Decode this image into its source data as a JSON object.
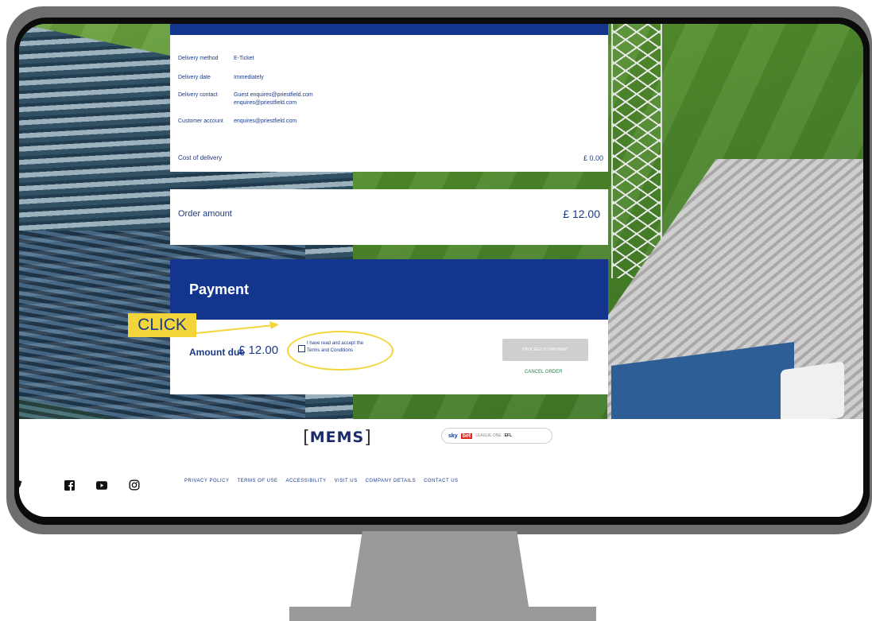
{
  "delivery": {
    "method_label": "Delivery method",
    "method_value": "E-Ticket",
    "date_label": "Delivery date",
    "date_value": "Immediately",
    "contact_label": "Delivery contact",
    "contact_value_1": "Guest enquires@priestfield.com",
    "contact_value_2": "enquires@priestfield.com",
    "account_label": "Customer account",
    "account_value": "enquires@priestfield.com",
    "cost_label": "Cost of delivery",
    "cost_value": "£ 0.00"
  },
  "order": {
    "amount_label": "Order amount",
    "amount_value": "£ 12.00"
  },
  "payment": {
    "title": "Payment",
    "amount_due_label": "Amount due",
    "amount_due_value": "£ 12.00",
    "terms_line_1": "I have read and accept the",
    "terms_link": "Terms and Conditions",
    "proceed_label": "PROCEED TO PAYMENT",
    "cancel_label": "CANCEL ORDER"
  },
  "annotation": {
    "click_label": "CLICK"
  },
  "footer": {
    "sponsor_mems": "MEMS",
    "sponsor_sky": "sky",
    "sponsor_bet": "bet",
    "sponsor_league": "LEAGUE ONE",
    "sponsor_efl": "EFL",
    "social_icons": [
      "twitter-icon",
      "facebook-icon",
      "youtube-icon",
      "instagram-icon"
    ],
    "links": [
      "PRIVACY POLICY",
      "TERMS OF USE",
      "ACCESSIBILITY",
      "VISIT US",
      "COMPANY DETAILS",
      "CONTACT US"
    ]
  },
  "colors": {
    "brand_blue": "#13358d",
    "highlight_yellow": "#f2d53a",
    "cancel_green": "#1e8a4a"
  }
}
